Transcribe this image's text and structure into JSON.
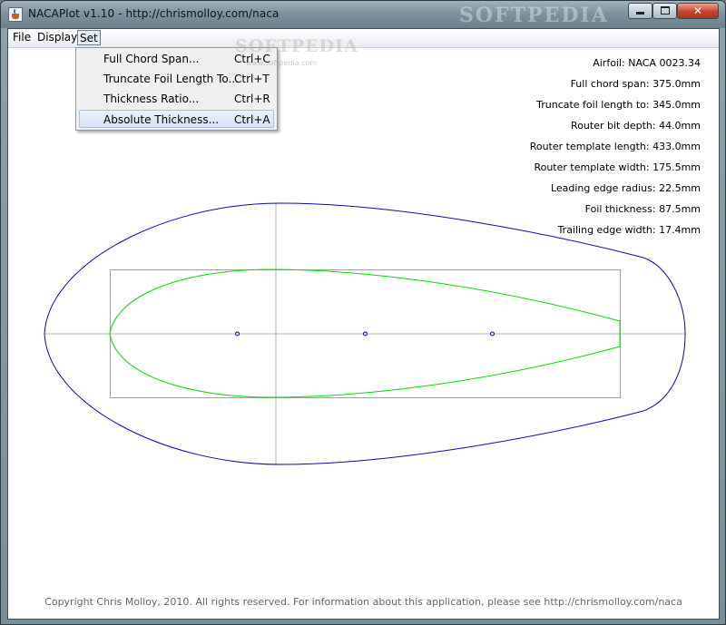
{
  "window": {
    "title": "NACAPlot v1.10 - http://chrismolloy.com/naca",
    "watermark": "SOFTPEDIA",
    "controls": {
      "minimize": "",
      "maximize": "",
      "close": "✕"
    }
  },
  "menubar": {
    "items": [
      {
        "label": "File"
      },
      {
        "label": "Display"
      },
      {
        "label": "Set"
      }
    ]
  },
  "set_menu": {
    "items": [
      {
        "label": "Full Chord Span...",
        "shortcut": "Ctrl+C"
      },
      {
        "label": "Truncate Foil Length To...",
        "shortcut": "Ctrl+T"
      },
      {
        "label": "Thickness Ratio...",
        "shortcut": "Ctrl+R"
      },
      {
        "label": "Absolute Thickness...",
        "shortcut": "Ctrl+A"
      }
    ],
    "watermark": "SOFTPEDIA",
    "watermark_small": "www.softpedia.com"
  },
  "info": [
    "Airfoil: NACA 0023.34",
    "Full chord span: 375.0mm",
    "Truncate foil length to: 345.0mm",
    "Router bit depth: 44.0mm",
    "Router template length: 433.0mm",
    "Router template width: 175.5mm",
    "Leading edge radius: 22.5mm",
    "Foil thickness: 87.5mm",
    "Trailing edge width: 17.4mm"
  ],
  "colors": {
    "template_outline": "#0a0ab4",
    "foil_outline": "#00dd00",
    "axes": "#b4b4b4",
    "bounding_box": "#a0a0a0"
  },
  "footer": "Copyright Chris Molloy, 2010. All rights reserved. For information about this application, please see http://chrismolloy.com/naca"
}
